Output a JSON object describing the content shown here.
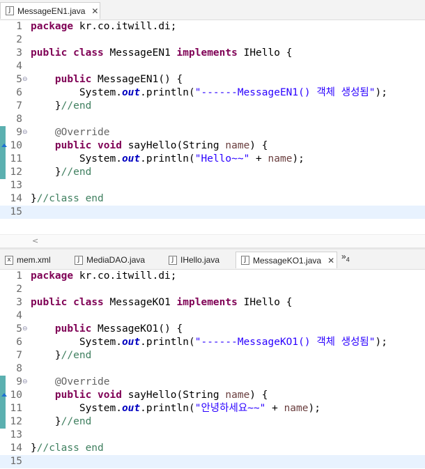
{
  "top_editor": {
    "tabs": [
      {
        "label": "MessageEN1.java",
        "icon": "java-file-icon",
        "active": true
      }
    ],
    "line_numbers": [
      "1",
      "2",
      "3",
      "4",
      "5",
      "6",
      "7",
      "8",
      "9",
      "10",
      "11",
      "12",
      "13",
      "14",
      "15"
    ],
    "code": {
      "l1": [
        "package",
        " kr.co.itwill.di;"
      ],
      "l3": [
        "public",
        " ",
        "class",
        " MessageEN1 ",
        "implements",
        " IHello {"
      ],
      "l5": [
        "    ",
        "public",
        " MessageEN1() {"
      ],
      "l6": [
        "        System.",
        "out",
        ".println(",
        "\"------MessageEN1() 객체 생성됨\"",
        ");"
      ],
      "l7": [
        "    }",
        "//end"
      ],
      "l9": [
        "    ",
        "@Override"
      ],
      "l10": [
        "    ",
        "public",
        " ",
        "void",
        " sayHello(String ",
        "name",
        ") {"
      ],
      "l11": [
        "        System.",
        "out",
        ".println(",
        "\"Hello~~\"",
        " + ",
        "name",
        ");"
      ],
      "l12": [
        "    }",
        "//end"
      ],
      "l14": [
        "}",
        "//class end"
      ]
    },
    "scroll_left_glyph": "<"
  },
  "bottom_editor": {
    "tabs": [
      {
        "label": "mem.xml",
        "icon": "xml-file-icon",
        "active": false
      },
      {
        "label": "MediaDAO.java",
        "icon": "java-file-icon",
        "active": false
      },
      {
        "label": "IHello.java",
        "icon": "java-file-icon",
        "active": false
      },
      {
        "label": "MessageKO1.java",
        "icon": "java-file-icon",
        "active": true
      }
    ],
    "overflow_label": "»",
    "overflow_count": "4",
    "line_numbers": [
      "1",
      "2",
      "3",
      "4",
      "5",
      "6",
      "7",
      "8",
      "9",
      "10",
      "11",
      "12",
      "13",
      "14",
      "15"
    ],
    "code": {
      "l1": [
        "package",
        " kr.co.itwill.di;"
      ],
      "l3": [
        "public",
        " ",
        "class",
        " MessageKO1 ",
        "implements",
        " IHello {"
      ],
      "l5": [
        "    ",
        "public",
        " MessageKO1() {"
      ],
      "l6": [
        "        System.",
        "out",
        ".println(",
        "\"------MessageKO1() 객체 생성됨\"",
        ");"
      ],
      "l7": [
        "    }",
        "//end"
      ],
      "l9": [
        "    ",
        "@Override"
      ],
      "l10": [
        "    ",
        "public",
        " ",
        "void",
        " sayHello(String ",
        "name",
        ") {"
      ],
      "l11": [
        "        System.",
        "out",
        ".println(",
        "\"안녕하세요~~\"",
        " + ",
        "name",
        ");"
      ],
      "l12": [
        "    }",
        "//end"
      ],
      "l14": [
        "}",
        "//class end"
      ]
    }
  },
  "icons": {
    "fold": "⊖",
    "close": "✕",
    "file_java": "J",
    "file_xml": "x"
  },
  "colors": {
    "keyword": "#7f0055",
    "string": "#2a00ff",
    "comment": "#3f7f5f",
    "field": "#0000c0",
    "annotation": "#646464",
    "current_line": "#e8f2fe"
  }
}
